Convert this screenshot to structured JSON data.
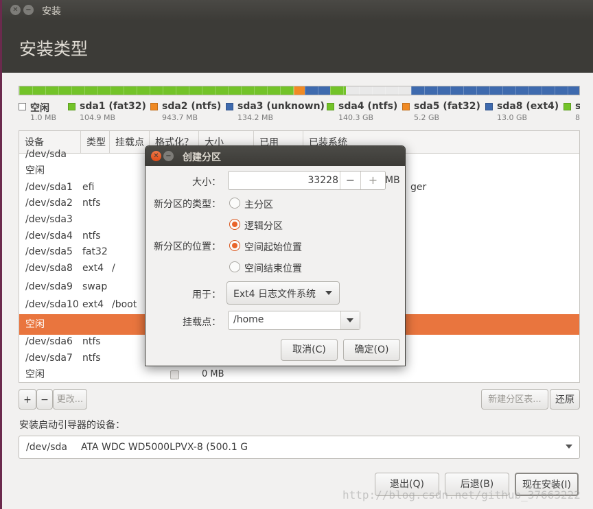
{
  "window": {
    "title": "安装"
  },
  "page": {
    "title": "安装类型"
  },
  "partition_bar": {
    "segments": [
      {
        "color": "#73c329"
      },
      {
        "color": "#f08a24"
      },
      {
        "color": "#3e6aae"
      },
      {
        "color": "#73c329"
      },
      {
        "color": "#e9e9e9"
      },
      {
        "color": "#3e6aae"
      }
    ]
  },
  "legend": [
    {
      "name": "空闲",
      "size": "1.0 MB",
      "color": "#ffffff"
    },
    {
      "name": "sda1 (fat32)",
      "size": "104.9 MB",
      "color": "#73c329"
    },
    {
      "name": "sda2 (ntfs)",
      "size": "943.7 MB",
      "color": "#f08a24"
    },
    {
      "name": "sda3 (unknown)",
      "size": "134.2 MB",
      "color": "#3e6aae"
    },
    {
      "name": "sda4 (ntfs)",
      "size": "140.3 GB",
      "color": "#73c329"
    },
    {
      "name": "sda5 (fat32)",
      "size": "5.2 GB",
      "color": "#f08a24"
    },
    {
      "name": "sda8 (ext4)",
      "size": "13.0 GB",
      "color": "#3e6aae"
    },
    {
      "name": "s",
      "size": "8",
      "color": "#73c329"
    }
  ],
  "table": {
    "headers": [
      "设备",
      "类型",
      "挂载点",
      "格式化？",
      "大小",
      "已用",
      "已装系统"
    ],
    "rows": [
      {
        "device": "/dev/sda",
        "type": "",
        "mount": "",
        "size": "",
        "extra": ""
      },
      {
        "device": "空闲",
        "type": "",
        "mount": "",
        "size": "",
        "extra": ""
      },
      {
        "device": "/dev/sda1",
        "type": "efi",
        "mount": "",
        "size": "",
        "extra": "ger"
      },
      {
        "device": "/dev/sda2",
        "type": "ntfs",
        "mount": "",
        "size": "",
        "extra": ""
      },
      {
        "device": "/dev/sda3",
        "type": "",
        "mount": "",
        "size": "",
        "extra": ""
      },
      {
        "device": "/dev/sda4",
        "type": "ntfs",
        "mount": "",
        "size": "",
        "extra": ""
      },
      {
        "device": "/dev/sda5",
        "type": "fat32",
        "mount": "",
        "size": "",
        "extra": ""
      },
      {
        "device": "/dev/sda8",
        "type": "ext4",
        "mount": "/",
        "size": "",
        "extra": ""
      },
      {
        "device": "/dev/sda9",
        "type": "swap",
        "mount": "",
        "size": "",
        "extra": ""
      },
      {
        "device": "/dev/sda10",
        "type": "ext4",
        "mount": "/boot",
        "size": "",
        "extra": ""
      },
      {
        "device": "空闲",
        "type": "",
        "mount": "",
        "size": "",
        "extra": ""
      },
      {
        "device": "/dev/sda6",
        "type": "ntfs",
        "mount": "",
        "size": "",
        "extra": ""
      },
      {
        "device": "/dev/sda7",
        "type": "ntfs",
        "mount": "",
        "size": "",
        "extra": ""
      },
      {
        "device": "空闲",
        "type": "",
        "mount": "",
        "size": "0 MB",
        "extra": ""
      }
    ]
  },
  "table_buttons": {
    "add": "+",
    "remove": "−",
    "change": "更改...",
    "new_table": "新建分区表...",
    "revert": "还原"
  },
  "boot": {
    "label": "安装启动引导器的设备：",
    "device": "/dev/sda",
    "model": "ATA WDC WD5000LPVX-8 (500.1 G"
  },
  "footer": {
    "quit": "退出(Q)",
    "back": "后退(B)",
    "install": "现在安装(I)"
  },
  "watermark": "http://blog.csdn.net/github_37663222",
  "dialog": {
    "title": "创建分区",
    "size_label": "大小：",
    "size_value": "33228",
    "size_minus": "−",
    "size_plus": "+",
    "size_unit": "MB",
    "type_label": "新分区的类型：",
    "type_primary": "主分区",
    "type_logical": "逻辑分区",
    "location_label": "新分区的位置：",
    "location_begin": "空间起始位置",
    "location_end": "空间结束位置",
    "use_label": "用于：",
    "use_value": "Ext4 日志文件系统",
    "mount_label": "挂载点：",
    "mount_value": "/home",
    "cancel": "取消(C)",
    "ok": "确定(O)"
  }
}
